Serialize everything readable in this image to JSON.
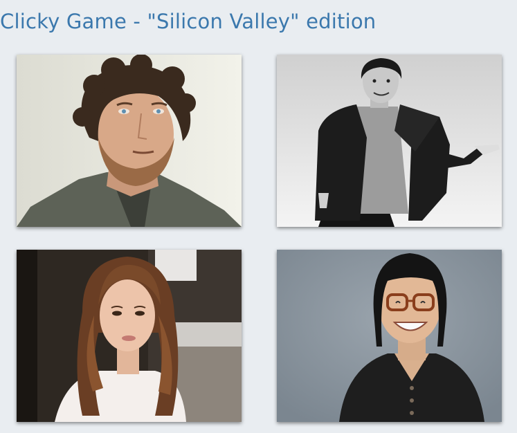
{
  "header": {
    "title": "Clicky Game - \"Silicon Valley\" edition",
    "title_color": "#3b78ad"
  },
  "cards": [
    {
      "subject": "curly-haired bearded man in grey shirt"
    },
    {
      "subject": "tall man in black blazer, black and white photo"
    },
    {
      "subject": "woman with long wavy brown hair"
    },
    {
      "subject": "smiling man with glasses in black shirt"
    }
  ],
  "colors": {
    "background": "#e9edf1"
  }
}
